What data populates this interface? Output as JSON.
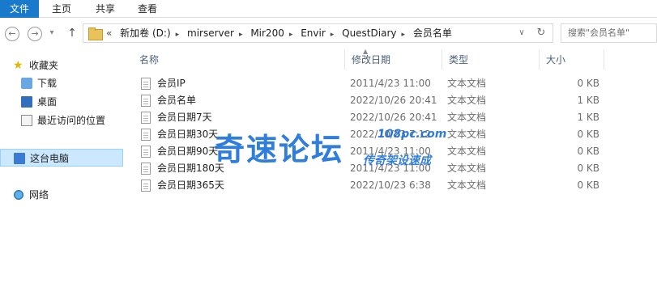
{
  "ribbon": {
    "tabs": [
      "文件",
      "主页",
      "共享",
      "查看"
    ]
  },
  "nav": {
    "back": "←",
    "forward": "→",
    "recent": "▾",
    "up": "↑"
  },
  "address": {
    "overflow": "«",
    "crumbs": [
      "新加卷 (D:)",
      "mirserver",
      "Mir200",
      "Envir",
      "QuestDiary",
      "会员名单"
    ],
    "separator": "▸",
    "dropdown": "∨",
    "refresh": "↻"
  },
  "search": {
    "placeholder": "搜索\"会员名单\""
  },
  "sidebar": {
    "items": [
      {
        "label": "收藏夹",
        "icon": "star-icon"
      },
      {
        "label": "下载",
        "icon": "downloads-folder-icon"
      },
      {
        "label": "桌面",
        "icon": "desktop-icon"
      },
      {
        "label": "最近访问的位置",
        "icon": "recent-places-icon"
      },
      {
        "label": "这台电脑",
        "icon": "computer-icon"
      },
      {
        "label": "网络",
        "icon": "network-icon"
      }
    ]
  },
  "columns": {
    "name": "名称",
    "date": "修改日期",
    "type": "类型",
    "size": "大小"
  },
  "files": [
    {
      "name": "会员IP",
      "date": "2011/4/23 11:00",
      "type": "文本文档",
      "size": "0 KB"
    },
    {
      "name": "会员名单",
      "date": "2022/10/26 20:41",
      "type": "文本文档",
      "size": "1 KB"
    },
    {
      "name": "会员日期7天",
      "date": "2022/10/26 20:41",
      "type": "文本文档",
      "size": "1 KB"
    },
    {
      "name": "会员日期30天",
      "date": "2022/10/23 7:12",
      "type": "文本文档",
      "size": "0 KB"
    },
    {
      "name": "会员日期90天",
      "date": "2011/4/23 11:00",
      "type": "文本文档",
      "size": "0 KB"
    },
    {
      "name": "会员日期180天",
      "date": "2011/4/23 11:00",
      "type": "文本文档",
      "size": "0 KB"
    },
    {
      "name": "会员日期365天",
      "date": "2022/10/23 6:38",
      "type": "文本文档",
      "size": "0 KB"
    }
  ],
  "watermark": {
    "main": "奇速论坛",
    "url": "108pc.com",
    "sub": "传奇架设速成"
  },
  "colors": {
    "file_tab": "#1979ca",
    "selection": "#cce8ff",
    "watermark": "#1a6fd8"
  }
}
